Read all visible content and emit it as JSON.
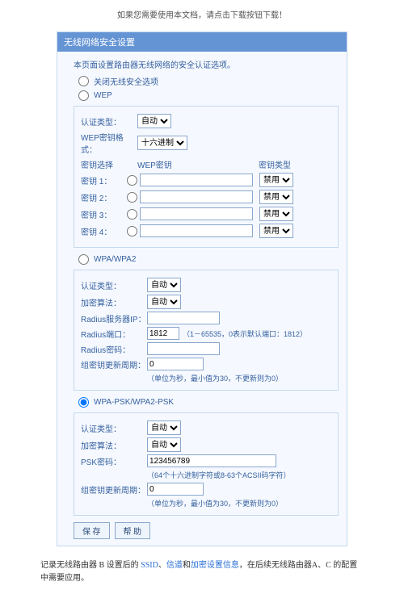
{
  "top_note": "如果您需要使用本文档，请点击下载按钮下载！",
  "header": "无线网络安全设置",
  "intro": "本页面设置路由器无线网络的安全认证选项。",
  "opt_close": "关闭无线安全选项",
  "wep": {
    "title": "WEP",
    "auth_label": "认证类型：",
    "auth_value": "自动",
    "fmt_label": "WEP密钥格式：",
    "fmt_value": "十六进制",
    "sel_label": "密钥选择",
    "pw_label": "WEP密钥",
    "type_label": "密钥类型",
    "rows": [
      {
        "label": "密钥 1：",
        "val": "",
        "type": "禁用"
      },
      {
        "label": "密钥 2：",
        "val": "",
        "type": "禁用"
      },
      {
        "label": "密钥 3：",
        "val": "",
        "type": "禁用"
      },
      {
        "label": "密钥 4：",
        "val": "",
        "type": "禁用"
      }
    ]
  },
  "wpa": {
    "title": "WPA/WPA2",
    "auth_label": "认证类型：",
    "auth_value": "自动",
    "enc_label": "加密算法：",
    "enc_value": "自动",
    "radius_ip_label": "Radius服务器IP：",
    "radius_ip": "",
    "radius_port_label": "Radius端口：",
    "radius_port": "1812",
    "radius_port_hint": "（1－65535，0表示默认端口：1812）",
    "radius_pw_label": "Radius密码：",
    "radius_pw": "",
    "renew_label": "组密钥更新周期：",
    "renew": "0",
    "renew_hint": "（单位为秒，最小值为30，不更新则为0）"
  },
  "psk": {
    "title": "WPA-PSK/WPA2-PSK",
    "auth_label": "认证类型：",
    "auth_value": "自动",
    "enc_label": "加密算法：",
    "enc_value": "自动",
    "pw_label": "PSK密码：",
    "pw": "123456789",
    "pw_hint": "（64个十六进制字符或8-63个ACSII码字符）",
    "renew_label": "组密钥更新周期：",
    "renew": "0",
    "renew_hint": "（单位为秒，最小值为30，不更新则为0）"
  },
  "btn_save": "保 存",
  "btn_help": "帮 助",
  "caption_pre": "记录无线路由器 B 设置后的",
  "caption_kw1": "SSID",
  "caption_sep1": "、",
  "caption_kw2": "信道",
  "caption_sep2": "和",
  "caption_kw3": "加密设置信息",
  "caption_post": "，在后续无线路由器A、C 的配置中需要应用。"
}
